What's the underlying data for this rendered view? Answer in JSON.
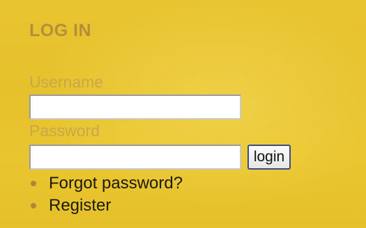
{
  "login_box": {
    "title": "LOG IN",
    "username_label": "Username",
    "username_value": "",
    "password_label": "Password",
    "password_value": "",
    "login_button": "login",
    "links": [
      {
        "label": "Forgot password?"
      },
      {
        "label": "Register"
      }
    ]
  },
  "colors": {
    "panel_background": "#e6c12c",
    "title_text": "#b48e3a",
    "label_text": "#c9a74a",
    "link_text": "#1c1a10",
    "bullet": "#b2863a",
    "button_border": "#3c4a8a"
  },
  "icons": {
    "bullet": "bullet-icon"
  }
}
